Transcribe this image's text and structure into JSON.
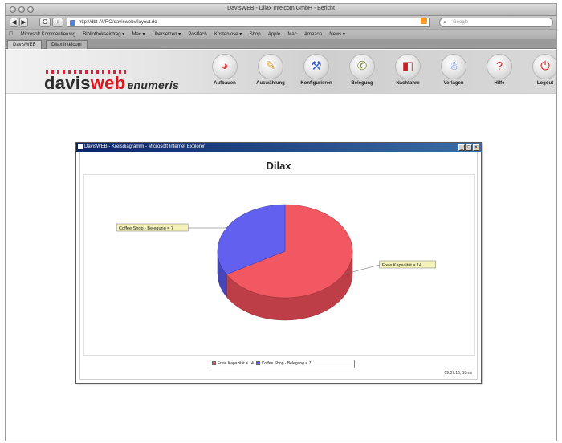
{
  "browser": {
    "window_title": "DavisWEB - Dilax Intelcom GmbH - Bericht",
    "url": "http://dbt-AVRO/daviswebv/layout.do",
    "search_placeholder": "Google",
    "back_label": "◀",
    "forward_label": "▶",
    "reload_label": "C",
    "add_label": "+",
    "bookmarks": [
      "Microsoft Kommentierung",
      "Bibliothekseintrag ▾",
      "Mac ▾",
      "Übersetzen ▾",
      "Postfach",
      "Kostenlose ▾",
      "Shop",
      "Apple",
      "Mac",
      "Amazon",
      "News ▾"
    ],
    "tabs": [
      "DavisWEB",
      "Dilax Intelcom"
    ]
  },
  "app": {
    "logo_part1": "davis",
    "logo_part2": "web",
    "logo_part3": "enumeris",
    "nav": [
      {
        "label": "Aufbauen",
        "icon": "aufbauen-icon",
        "glyph": "◕",
        "color": "#e14848"
      },
      {
        "label": "Auswählung",
        "icon": "auswaehlung-icon",
        "glyph": "✎",
        "color": "#d8a030"
      },
      {
        "label": "Konfigurieren",
        "icon": "konfigurieren-icon",
        "glyph": "⚒",
        "color": "#3a5fc8"
      },
      {
        "label": "Belegung",
        "icon": "belegung-icon",
        "glyph": "✆",
        "color": "#7a8a40"
      },
      {
        "label": "Nachfahre",
        "icon": "nachfahre-icon",
        "glyph": "◧",
        "color": "#c81e2a"
      },
      {
        "label": "Verlagen",
        "icon": "verlagen-icon",
        "glyph": "☃",
        "color": "#4a6fd8"
      },
      {
        "label": "Hilfe",
        "icon": "help-icon",
        "glyph": "?",
        "color": "#c81e2a"
      },
      {
        "label": "Logout",
        "icon": "logout-icon",
        "glyph": "⏻",
        "color": "#d83030"
      }
    ]
  },
  "popup": {
    "title": "DavisWEB - Kreisdiagramm - Microsoft Internet Explorer",
    "footer": "09.07.10, 10ms"
  },
  "chart_data": {
    "type": "pie",
    "title": "Dilax",
    "style": "3d",
    "slices": [
      {
        "label": "Freie Kapazität",
        "value": 14,
        "color": "#f2505a"
      },
      {
        "label": "Coffee Shop - Belegung",
        "value": 7,
        "color": "#5a58ef"
      }
    ],
    "callouts": [
      "Freie Kapazität = 14",
      "Coffee Shop - Belegung = 7"
    ],
    "legend_entries": [
      "Freie Kapazität = 14",
      "Coffee Shop - Belegung = 7"
    ],
    "legend_position": "bottom"
  },
  "colors": {
    "logo_red": "#d41921",
    "titlebar_blue": "#0a246a"
  }
}
